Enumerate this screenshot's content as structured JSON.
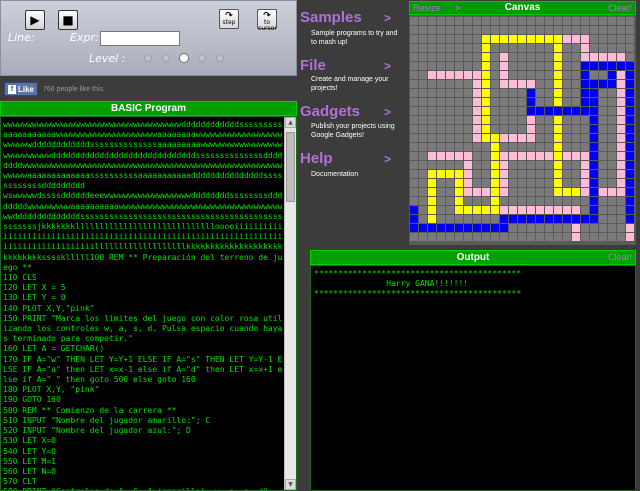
{
  "controls": {
    "line_label": "Line:",
    "expr_label": "Expr:",
    "expr_value": "",
    "level_label": "Level :",
    "step_label": "step",
    "to_cursor_label": "to cursor",
    "level_selected_index": 2,
    "level_count": 5
  },
  "like": {
    "button_label": "Like",
    "count_text": "766 people like this."
  },
  "program": {
    "title": "BASIC Program",
    "code": "wwwwwwwwwwwwwwwwwwwwwwwwwwwwwwwwwwwwwddddddddddddsssssssssaaaaaaaaaaawwwwwwwwwwwwwwwwwwwwwaaaaaaaawwwwwwwwwwwwwwwwwwwwwwwwddddddddddddssssssssssssssaaaaaaaaawwwwwwwwwwwwwwwwwwwwwwwwwwwddddddddddddddddddddddddddddddssssssssssssssddddddddwwwwwwwwwwwwwwwwwwwwwwwwwwwwwwwwwwwwwwwwwwwwwwwwwwwwwwwwwwwaaaaaaaaaaaaassssssssssaaaaaaaaaaadddddddddddddddssssssssssssddddddddd\nwswwwwwdssssddddddeeewwwwwwwwwwwwwwwwwwddddddddssssssssddddddddwwwwwwwwwaaaaaaaaaawwwwwwwwwwwwwwwwwwwwwwwwwwwwwwwwwwwwddddddddddddddsssssssssssssssssssssssssssssssssssssssssssssssssjkkkkkkklllllllllllllllllllllllllllllooooiiiiiiiiiiiiiiiiiiiiiiiiiiiiiiiiiiiiiiiiiiiiiiiiiiiiiiiiiiiiiiiiiiiiiiiiiiiiiiiiiiiiiiilllllllllllllllllllkkkkkkkkkkkkkkkkkkkkkkkkkkkkssssklllll100 REM ** Preparación del terreno de juego **\n110 CLS\n120 LET X = 5\n130 LET Y = 0\n140 PLOT X,Y,\"pink\"\n150 PRINT \"Marca los limites del juego con color rosa utilizando los controles w, a, s, d. Pulsa espacio cuando hayas terminado para competir.\"\n160 LET A = GETCHAR()\n170 IF A=\"w\" THEN LET Y=Y+1 ELSE IF A=\"s\" THEN LET Y=Y-1 ELSE IF A=\"a\" then LET x=x-1 else if A=\"d\" then LET x=x+1 else if A=\" \" then goto 500 else goto 160\n180 PLOT X,Y, \"pink\"\n190 GOTO 160\n500 REM ** Comienzo de la carrera **\n510 INPUT \"Nombre del jugador amarillo:\"; C\n520 INPUT \"Nombre del jugador azul:\"; D\n530 LET X=0\n540 LET Y=0\n550 LET M=1\n560 LET N=0\n570 CLT\n580 PRINT \"Controles de \"; C; \" (amarillo): w, a, s, d\""
  },
  "menu": [
    {
      "title": "Samples",
      "desc": "Sample programs to try and to mash up!"
    },
    {
      "title": "File",
      "desc": "Create and manage your projects!"
    },
    {
      "title": "Gadgets",
      "desc": "Publish your projects using Google Gadgets!"
    },
    {
      "title": "Help",
      "desc": "Documentation"
    }
  ],
  "menu_arrow": ">",
  "canvas": {
    "title": "Canvas",
    "resize_label": "Resize",
    "resize_arrow": ">",
    "clear_label": "Clear!",
    "grid_cols": 25,
    "grid_rows": 25,
    "colors": {
      "grid": "#5a5a5a",
      "cell": "#7a7a7a",
      "pink": "#ffbcd6",
      "yellow": "#ffff00",
      "blue": "#0000ee"
    },
    "paths": {
      "pink": [
        [
          2,
          18
        ],
        [
          2,
          15
        ],
        [
          3,
          15
        ],
        [
          4,
          15
        ],
        [
          5,
          15
        ],
        [
          6,
          15
        ],
        [
          6,
          16
        ],
        [
          6,
          17
        ],
        [
          6,
          18
        ],
        [
          6,
          19
        ],
        [
          7,
          19
        ],
        [
          8,
          19
        ],
        [
          9,
          19
        ],
        [
          10,
          19
        ],
        [
          10,
          18
        ],
        [
          10,
          17
        ],
        [
          10,
          16
        ],
        [
          10,
          15
        ],
        [
          11,
          15
        ],
        [
          12,
          15
        ],
        [
          13,
          15
        ],
        [
          14,
          15
        ],
        [
          15,
          15
        ],
        [
          16,
          15
        ],
        [
          17,
          15
        ],
        [
          18,
          15
        ],
        [
          19,
          15
        ],
        [
          19,
          16
        ],
        [
          19,
          17
        ],
        [
          19,
          18
        ],
        [
          19,
          19
        ],
        [
          20,
          19
        ],
        [
          21,
          19
        ],
        [
          22,
          19
        ],
        [
          23,
          19
        ],
        [
          24,
          19
        ],
        [
          24,
          20
        ],
        [
          24,
          21
        ],
        [
          24,
          22
        ],
        [
          24,
          23
        ],
        [
          24,
          24
        ]
      ],
      "pink2": [
        [
          2,
          6
        ],
        [
          3,
          6
        ],
        [
          4,
          6
        ],
        [
          5,
          6
        ],
        [
          6,
          6
        ],
        [
          7,
          6
        ],
        [
          7,
          7
        ],
        [
          7,
          8
        ],
        [
          7,
          9
        ],
        [
          7,
          10
        ],
        [
          7,
          11
        ],
        [
          7,
          12
        ],
        [
          7,
          13
        ],
        [
          8,
          13
        ],
        [
          9,
          13
        ],
        [
          10,
          13
        ],
        [
          11,
          13
        ],
        [
          12,
          13
        ],
        [
          13,
          13
        ],
        [
          13,
          12
        ],
        [
          13,
          11
        ],
        [
          13,
          10
        ],
        [
          13,
          9
        ],
        [
          13,
          8
        ],
        [
          13,
          7
        ],
        [
          12,
          7
        ],
        [
          11,
          7
        ],
        [
          10,
          7
        ],
        [
          10,
          6
        ],
        [
          10,
          5
        ],
        [
          10,
          4
        ]
      ],
      "pink3": [
        [
          16,
          2
        ],
        [
          17,
          2
        ],
        [
          18,
          2
        ],
        [
          19,
          2
        ],
        [
          19,
          3
        ],
        [
          19,
          4
        ],
        [
          20,
          4
        ],
        [
          21,
          4
        ],
        [
          22,
          4
        ],
        [
          23,
          4
        ],
        [
          23,
          5
        ],
        [
          23,
          6
        ],
        [
          23,
          7
        ],
        [
          23,
          8
        ],
        [
          23,
          9
        ],
        [
          23,
          10
        ],
        [
          23,
          11
        ],
        [
          23,
          12
        ],
        [
          23,
          13
        ],
        [
          23,
          14
        ],
        [
          23,
          15
        ],
        [
          23,
          16
        ],
        [
          23,
          17
        ],
        [
          23,
          18
        ],
        [
          24,
          18
        ]
      ],
      "pink4": [
        [
          10,
          21
        ],
        [
          11,
          21
        ],
        [
          12,
          21
        ],
        [
          13,
          21
        ],
        [
          14,
          21
        ],
        [
          15,
          21
        ],
        [
          16,
          21
        ],
        [
          17,
          21
        ],
        [
          18,
          21
        ],
        [
          18,
          22
        ],
        [
          18,
          23
        ],
        [
          18,
          24
        ]
      ],
      "yellow": [
        [
          0,
          21
        ],
        [
          0,
          22
        ],
        [
          0,
          23
        ],
        [
          1,
          23
        ],
        [
          2,
          23
        ],
        [
          2,
          22
        ],
        [
          2,
          21
        ],
        [
          2,
          20
        ],
        [
          2,
          19
        ],
        [
          2,
          18
        ],
        [
          2,
          17
        ],
        [
          3,
          17
        ],
        [
          4,
          17
        ],
        [
          5,
          17
        ],
        [
          5,
          18
        ],
        [
          5,
          19
        ],
        [
          5,
          20
        ],
        [
          5,
          21
        ],
        [
          6,
          21
        ],
        [
          7,
          21
        ],
        [
          8,
          21
        ],
        [
          9,
          21
        ],
        [
          9,
          20
        ],
        [
          9,
          19
        ],
        [
          9,
          18
        ],
        [
          9,
          17
        ],
        [
          9,
          16
        ],
        [
          9,
          15
        ],
        [
          9,
          14
        ],
        [
          9,
          13
        ],
        [
          8,
          13
        ],
        [
          8,
          12
        ],
        [
          8,
          11
        ],
        [
          8,
          10
        ],
        [
          8,
          9
        ],
        [
          8,
          8
        ],
        [
          8,
          7
        ],
        [
          8,
          6
        ],
        [
          8,
          5
        ],
        [
          8,
          4
        ],
        [
          8,
          3
        ],
        [
          8,
          2
        ],
        [
          9,
          2
        ],
        [
          10,
          2
        ],
        [
          11,
          2
        ],
        [
          12,
          2
        ],
        [
          13,
          2
        ],
        [
          14,
          2
        ],
        [
          15,
          2
        ],
        [
          16,
          2
        ],
        [
          16,
          3
        ],
        [
          16,
          4
        ],
        [
          16,
          5
        ],
        [
          16,
          6
        ],
        [
          16,
          7
        ],
        [
          16,
          8
        ],
        [
          16,
          9
        ],
        [
          16,
          10
        ],
        [
          16,
          11
        ],
        [
          16,
          12
        ],
        [
          16,
          13
        ],
        [
          16,
          14
        ],
        [
          16,
          15
        ],
        [
          16,
          16
        ],
        [
          16,
          17
        ],
        [
          16,
          18
        ],
        [
          16,
          19
        ],
        [
          17,
          19
        ],
        [
          18,
          19
        ]
      ],
      "blue": [
        [
          0,
          21
        ],
        [
          0,
          22
        ],
        [
          0,
          23
        ],
        [
          1,
          23
        ],
        [
          2,
          23
        ],
        [
          3,
          23
        ],
        [
          4,
          23
        ],
        [
          5,
          23
        ],
        [
          6,
          23
        ],
        [
          7,
          23
        ],
        [
          8,
          23
        ],
        [
          9,
          23
        ],
        [
          10,
          23
        ],
        [
          10,
          22
        ],
        [
          11,
          22
        ],
        [
          12,
          22
        ],
        [
          13,
          22
        ],
        [
          14,
          22
        ],
        [
          15,
          22
        ],
        [
          16,
          22
        ],
        [
          17,
          22
        ],
        [
          18,
          22
        ],
        [
          19,
          22
        ],
        [
          20,
          22
        ],
        [
          20,
          21
        ],
        [
          20,
          20
        ],
        [
          20,
          19
        ],
        [
          20,
          18
        ],
        [
          20,
          17
        ],
        [
          20,
          16
        ],
        [
          20,
          15
        ],
        [
          20,
          14
        ],
        [
          20,
          13
        ],
        [
          20,
          12
        ],
        [
          20,
          11
        ],
        [
          20,
          10
        ],
        [
          20,
          9
        ],
        [
          20,
          8
        ],
        [
          20,
          7
        ],
        [
          21,
          7
        ],
        [
          22,
          7
        ],
        [
          22,
          6
        ],
        [
          22,
          5
        ],
        [
          23,
          5
        ],
        [
          24,
          5
        ],
        [
          24,
          6
        ],
        [
          24,
          7
        ],
        [
          24,
          8
        ],
        [
          24,
          9
        ],
        [
          24,
          10
        ],
        [
          24,
          11
        ],
        [
          24,
          12
        ],
        [
          24,
          13
        ],
        [
          24,
          14
        ],
        [
          24,
          15
        ],
        [
          24,
          16
        ],
        [
          24,
          17
        ],
        [
          24,
          18
        ],
        [
          24,
          19
        ],
        [
          24,
          20
        ],
        [
          24,
          21
        ],
        [
          24,
          22
        ]
      ],
      "blue2": [
        [
          13,
          8
        ],
        [
          13,
          9
        ],
        [
          13,
          10
        ],
        [
          14,
          10
        ],
        [
          15,
          10
        ],
        [
          16,
          10
        ],
        [
          17,
          10
        ],
        [
          18,
          10
        ],
        [
          19,
          10
        ],
        [
          19,
          9
        ],
        [
          19,
          8
        ],
        [
          19,
          7
        ],
        [
          19,
          6
        ],
        [
          19,
          5
        ],
        [
          20,
          5
        ],
        [
          21,
          5
        ],
        [
          22,
          5
        ]
      ]
    }
  },
  "output": {
    "title": "Output",
    "clear_label": "Clear!",
    "lines": "*******************************************\n               Harry GANA!!!!!!!\n*******************************************"
  }
}
